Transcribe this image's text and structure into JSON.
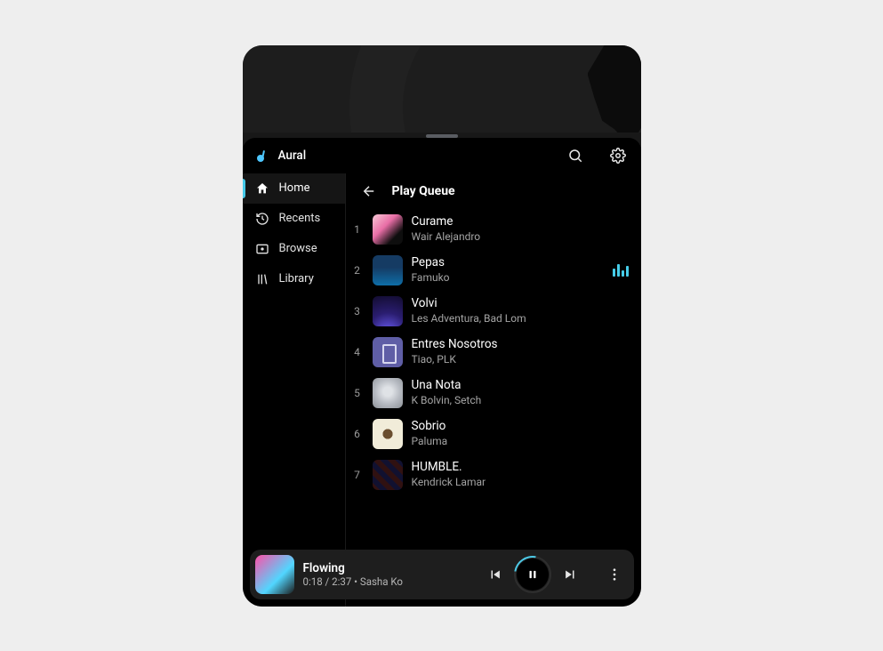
{
  "app": {
    "name": "Aural"
  },
  "sidebar": {
    "items": [
      {
        "label": "Home",
        "active": true
      },
      {
        "label": "Recents",
        "active": false
      },
      {
        "label": "Browse",
        "active": false
      },
      {
        "label": "Library",
        "active": false
      }
    ]
  },
  "content": {
    "title": "Play Queue"
  },
  "queue": [
    {
      "index": "1",
      "title": "Curame",
      "artist": "Wair Alejandro",
      "now_playing": false
    },
    {
      "index": "2",
      "title": "Pepas",
      "artist": "Famuko",
      "now_playing": true
    },
    {
      "index": "3",
      "title": "Volvi",
      "artist": "Les Adventura, Bad Lom",
      "now_playing": false
    },
    {
      "index": "4",
      "title": "Entres Nosotros",
      "artist": "Tiao, PLK",
      "now_playing": false
    },
    {
      "index": "5",
      "title": "Una Nota",
      "artist": "K Bolvin, Setch",
      "now_playing": false
    },
    {
      "index": "6",
      "title": "Sobrio",
      "artist": "Paluma",
      "now_playing": false
    },
    {
      "index": "7",
      "title": "HUMBLE.",
      "artist": "Kendrick Lamar",
      "now_playing": false
    }
  ],
  "player": {
    "title": "Flowing",
    "subtitle": "0:18 / 2:37 • Sasha Ko"
  }
}
